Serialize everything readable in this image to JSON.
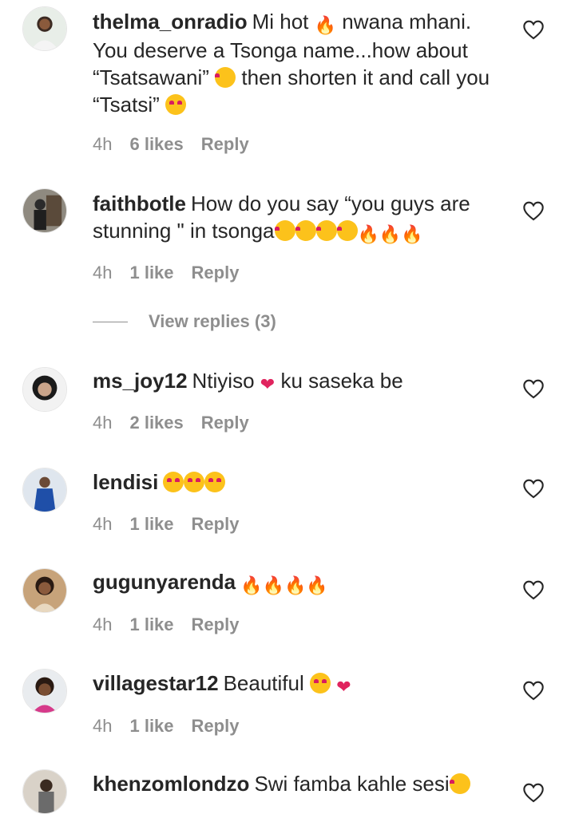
{
  "comments": [
    {
      "username": "thelma_onradio",
      "text_parts": [
        "Mi hot ",
        " nwana mhani. You deserve a Tsonga name...how about “Tsatsawani” ",
        " then shorten it and call you “Tsatsi” "
      ],
      "time": "4h",
      "likes": "6 likes",
      "reply": "Reply",
      "emojis": [
        "fire",
        "smiling-face",
        "heart-eyes"
      ]
    },
    {
      "username": "faithbotle",
      "text": "How do you say “you guys are stunning \" in tsonga",
      "time": "4h",
      "likes": "1 like",
      "reply": "Reply",
      "emojis": [
        "crying-face",
        "crying-face",
        "crying-face",
        "crying-face",
        "fire",
        "fire",
        "fire"
      ]
    },
    {
      "username": "ms_joy12",
      "text_parts": [
        "Ntiyiso ",
        " ku saseka be"
      ],
      "time": "4h",
      "likes": "2 likes",
      "reply": "Reply",
      "emojis": [
        "red-heart"
      ]
    },
    {
      "username": "lendisi",
      "text": "",
      "time": "4h",
      "likes": "1 like",
      "reply": "Reply",
      "emojis": [
        "heart-eyes",
        "heart-eyes",
        "heart-eyes"
      ]
    },
    {
      "username": "gugunyarenda",
      "text": "",
      "time": "4h",
      "likes": "1 like",
      "reply": "Reply",
      "emojis": [
        "fire",
        "fire",
        "fire",
        "fire"
      ]
    },
    {
      "username": "villagestar12",
      "text": "Beautiful ",
      "time": "4h",
      "likes": "1 like",
      "reply": "Reply",
      "emojis": [
        "heart-eyes",
        "red-heart"
      ]
    },
    {
      "username": "khenzomlondzo",
      "text": "Swi famba kahle sesi",
      "emojis": [
        "raising-hands"
      ]
    }
  ],
  "view_replies": "View replies (3)",
  "colors": {
    "text": "#262626",
    "meta": "#8e8e8e",
    "fire": "#f4511e",
    "heart": "#e0245e",
    "emoji_face": "#fcc21b"
  }
}
